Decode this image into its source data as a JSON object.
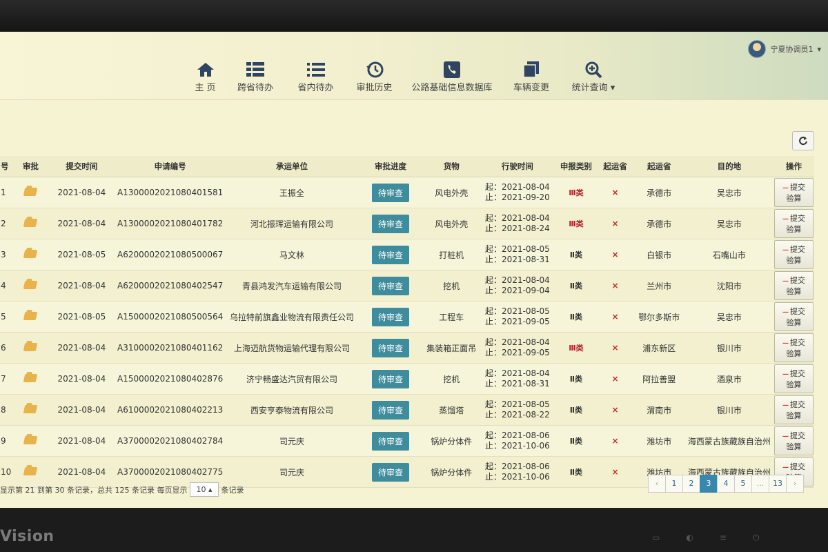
{
  "user": {
    "name": "宁夏协调员1"
  },
  "nav": [
    {
      "label": "主 页",
      "icon": "home-icon"
    },
    {
      "label": "跨省待办",
      "icon": "grid-list-icon"
    },
    {
      "label": "省内待办",
      "icon": "list-icon"
    },
    {
      "label": "审批历史",
      "icon": "history-icon"
    },
    {
      "label": "公路基础信息数据库",
      "icon": "phone-icon"
    },
    {
      "label": "车辆变更",
      "icon": "copy-icon"
    },
    {
      "label": "统计查询",
      "icon": "zoom-icon"
    }
  ],
  "table": {
    "headers": [
      "号",
      "审批",
      "提交时间",
      "申请编号",
      "承运单位",
      "审批进度",
      "货物",
      "行驶时间",
      "申报类别",
      "起运省",
      "起运省",
      "目的地",
      "操作"
    ],
    "rows": [
      {
        "no": "1",
        "date": "2021-08-04",
        "id": "A130000202108040158​1",
        "company": "王振全",
        "status": "待审查",
        "cargo": "风电外壳",
        "start": "起：2021-08-04",
        "end": "止：2021-09-20",
        "class": "Ⅲ类",
        "cls": "3",
        "from": "承德市",
        "to": "吴忠市",
        "action": "提交验算"
      },
      {
        "no": "2",
        "date": "2021-08-04",
        "id": "A130000202108040178​2",
        "company": "河北振珲运输有限公司",
        "status": "待审查",
        "cargo": "风电外壳",
        "start": "起：2021-08-04",
        "end": "止：2021-08-24",
        "class": "Ⅲ类",
        "cls": "3",
        "from": "承德市",
        "to": "吴忠市",
        "action": "提交验算"
      },
      {
        "no": "3",
        "date": "2021-08-05",
        "id": "A620000202108050006​7",
        "company": "马文林",
        "status": "待审查",
        "cargo": "打桩机",
        "start": "起：2021-08-05",
        "end": "止：2021-08-31",
        "class": "Ⅱ类",
        "cls": "2",
        "from": "白银市",
        "to": "石嘴山市",
        "action": "提交验算"
      },
      {
        "no": "4",
        "date": "2021-08-04",
        "id": "A620000202108040254​7",
        "company": "青县鸿发汽车运输有限公司",
        "status": "待审查",
        "cargo": "挖机",
        "start": "起：2021-08-04",
        "end": "止：2021-09-04",
        "class": "Ⅱ类",
        "cls": "2",
        "from": "兰州市",
        "to": "沈阳市",
        "action": "提交验算"
      },
      {
        "no": "5",
        "date": "2021-08-05",
        "id": "A150000202108050056​4",
        "company": "乌拉特前旗鑫业物流有限责任公司",
        "status": "待审查",
        "cargo": "工程车",
        "start": "起：2021-08-05",
        "end": "止：2021-09-05",
        "class": "Ⅱ类",
        "cls": "2",
        "from": "鄂尔多斯市",
        "to": "吴忠市",
        "action": "提交验算"
      },
      {
        "no": "6",
        "date": "2021-08-04",
        "id": "A310000202108040116​2",
        "company": "上海迈航货物运输代理有限公司",
        "status": "待审查",
        "cargo": "集装箱正面吊",
        "start": "起：2021-08-04",
        "end": "止：2021-09-05",
        "class": "Ⅲ类",
        "cls": "3",
        "from": "浦东新区",
        "to": "银川市",
        "action": "提交验算"
      },
      {
        "no": "7",
        "date": "2021-08-04",
        "id": "A150000202108040287​6",
        "company": "济宁畅盛达汽贸有限公司",
        "status": "待审查",
        "cargo": "挖机",
        "start": "起：2021-08-04",
        "end": "止：2021-08-31",
        "class": "Ⅱ类",
        "cls": "2",
        "from": "阿拉善盟",
        "to": "酒泉市",
        "action": "提交验算"
      },
      {
        "no": "8",
        "date": "2021-08-04",
        "id": "A610000202108040221​3",
        "company": "西安亨泰物流有限公司",
        "status": "待审查",
        "cargo": "蒸馏塔",
        "start": "起：2021-08-05",
        "end": "止：2021-08-22",
        "class": "Ⅱ类",
        "cls": "2",
        "from": "渭南市",
        "to": "银川市",
        "action": "提交验算"
      },
      {
        "no": "9",
        "date": "2021-08-04",
        "id": "A370000202108040278​4",
        "company": "司元庆",
        "status": "待审查",
        "cargo": "锅炉分体件",
        "start": "起：2021-08-06",
        "end": "止：2021-10-06",
        "class": "Ⅱ类",
        "cls": "2",
        "from": "潍坊市",
        "to": "海西蒙古族藏族自治州",
        "action": "提交验算"
      },
      {
        "no": "10",
        "date": "2021-08-04",
        "id": "A370000202108040277​5",
        "company": "司元庆",
        "status": "待审查",
        "cargo": "锅炉分体件",
        "start": "起：2021-08-06",
        "end": "止：2021-10-06",
        "class": "Ⅱ类",
        "cls": "2",
        "from": "潍坊市",
        "to": "海西蒙古族藏族自治州",
        "action": "提交验算"
      }
    ],
    "mark": "×"
  },
  "footer": {
    "info": "显示第 21 到第 30 条记录，总共 125 条记录 每页显示",
    "page_size": "10",
    "suffix": "条记录"
  },
  "pager": [
    "‹",
    "1",
    "2",
    "3",
    "4",
    "5",
    "...",
    "13",
    "›"
  ],
  "pager_active": "3",
  "bezel": {
    "brand": "Vision"
  }
}
